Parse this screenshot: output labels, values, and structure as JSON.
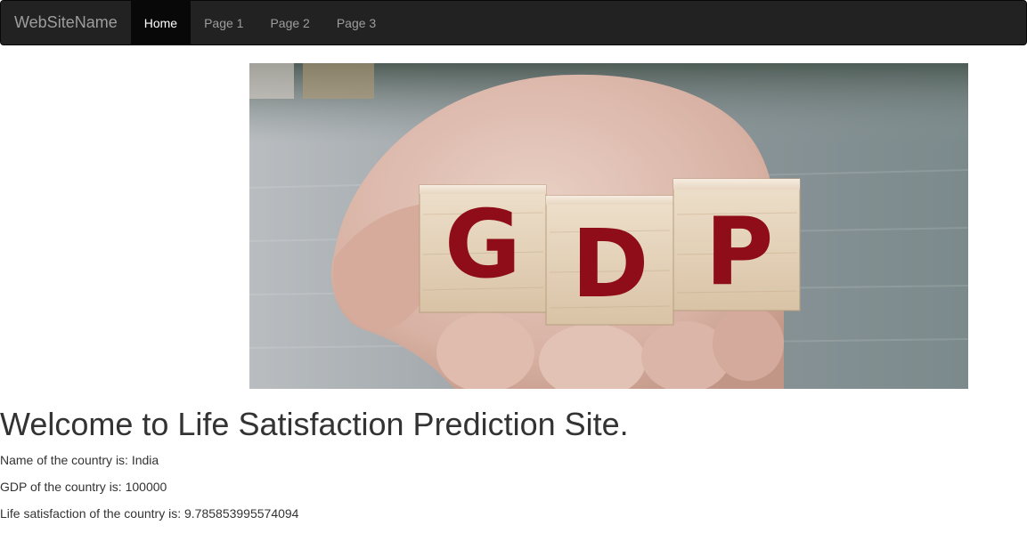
{
  "navbar": {
    "brand": "WebSiteName",
    "items": [
      {
        "label": "Home",
        "active": true
      },
      {
        "label": "Page 1",
        "active": false
      },
      {
        "label": "Page 2",
        "active": false
      },
      {
        "label": "Page 3",
        "active": false
      }
    ]
  },
  "hero": {
    "letters": [
      "G",
      "D",
      "P"
    ]
  },
  "main": {
    "heading": "Welcome to Life Satisfaction Prediction Site.",
    "country_line": "Name of the country is: India",
    "gdp_line": "GDP of the country is: 100000",
    "satisfaction_line": "Life satisfaction of the country is: 9.785853995574094"
  },
  "colors": {
    "navbar_bg": "#222222",
    "navbar_active_bg": "#080808",
    "navbar_text": "#9d9d9d",
    "letter_red": "#8f0d18"
  }
}
